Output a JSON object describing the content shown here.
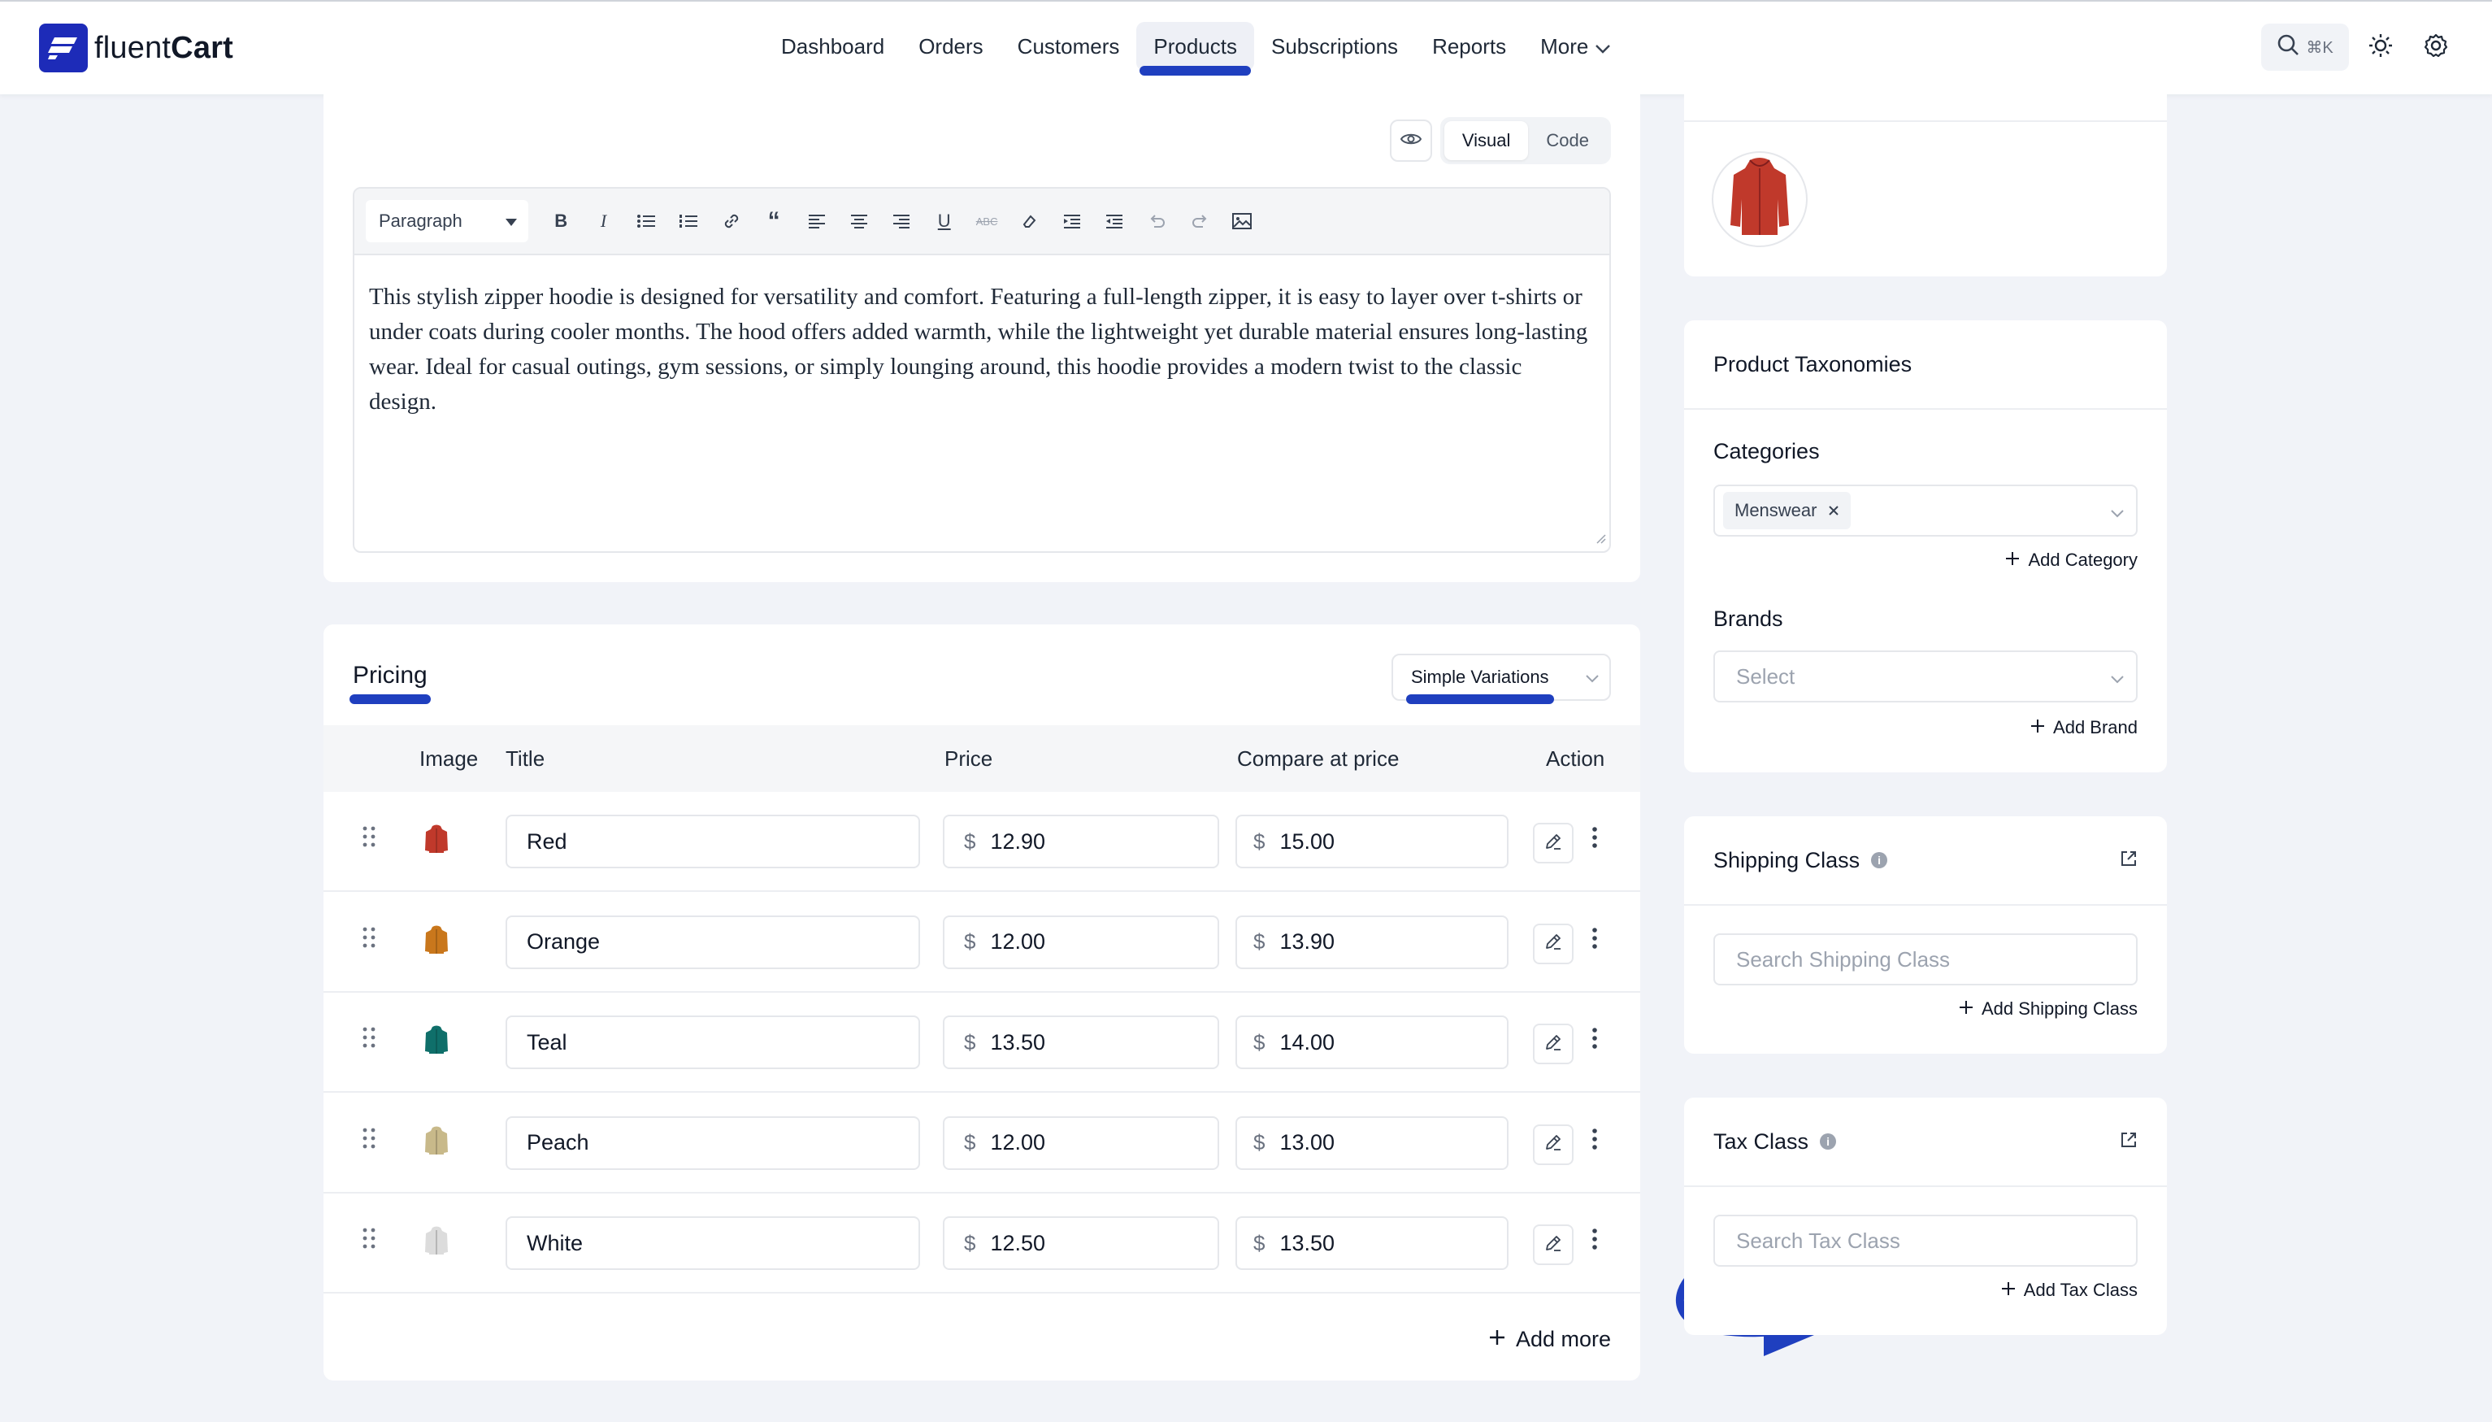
{
  "app": {
    "brand_prefix": "fluent",
    "brand_suffix": "Cart",
    "search_shortcut": "⌘K"
  },
  "nav": {
    "items": [
      {
        "label": "Dashboard"
      },
      {
        "label": "Orders"
      },
      {
        "label": "Customers"
      },
      {
        "label": "Products",
        "active": true
      },
      {
        "label": "Subscriptions"
      },
      {
        "label": "Reports"
      },
      {
        "label": "More"
      }
    ]
  },
  "editor": {
    "view_visual": "Visual",
    "view_code": "Code",
    "format": "Paragraph",
    "content": "This stylish zipper hoodie is designed for versatility and comfort. Featuring a full-length zipper, it is easy to layer over t-shirts or under coats during cooler months. The hood offers added warmth, while the lightweight yet durable material ensures long-lasting wear. Ideal for casual outings, gym sessions, or simply lounging around, this hoodie provides a modern twist to the classic design."
  },
  "pricing": {
    "title": "Pricing",
    "variation_type": "Simple Variations",
    "columns": {
      "image": "Image",
      "title": "Title",
      "price": "Price",
      "compare": "Compare at price",
      "action": "Action"
    },
    "currency": "$",
    "rows": [
      {
        "title": "Red",
        "price": "12.90",
        "compare": "15.00",
        "color": "#c0392b"
      },
      {
        "title": "Orange",
        "price": "12.00",
        "compare": "13.90",
        "color": "#c9771c"
      },
      {
        "title": "Teal",
        "price": "13.50",
        "compare": "14.00",
        "color": "#0f6f6a"
      },
      {
        "title": "Peach",
        "price": "12.00",
        "compare": "13.00",
        "color": "#c8b98a"
      },
      {
        "title": "White",
        "price": "12.50",
        "compare": "13.50",
        "color": "#dcdcdc"
      }
    ],
    "add_more": "Add more"
  },
  "taxonomies": {
    "title": "Product Taxonomies",
    "categories_label": "Categories",
    "category_chip": "Menswear",
    "add_category": "Add Category",
    "brands_label": "Brands",
    "brands_placeholder": "Select",
    "add_brand": "Add Brand"
  },
  "shipping": {
    "title": "Shipping Class",
    "search_placeholder": "Search Shipping Class",
    "add": "Add Shipping Class"
  },
  "tax": {
    "title": "Tax Class",
    "search_placeholder": "Search Tax Class",
    "add": "Add Tax Class"
  },
  "colors": {
    "accent": "#1f3fbf",
    "brand": "#1d2bb8",
    "product_main": "#c0392b"
  }
}
